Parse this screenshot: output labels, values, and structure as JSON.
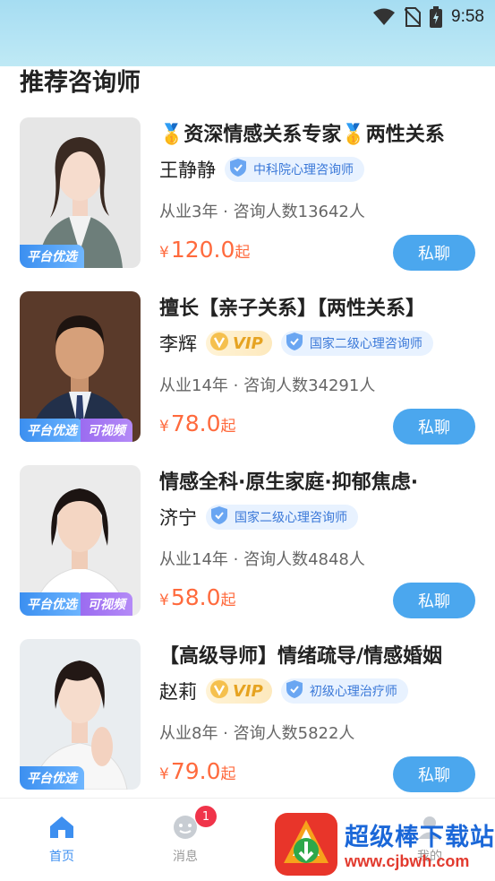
{
  "status_bar": {
    "time": "9:58"
  },
  "section_title": "推荐咨询师",
  "counselors": [
    {
      "title": "🥇资深情感关系专家🥇两性关系",
      "name": "王静静",
      "vip": "",
      "cert": "中科院心理咨询师",
      "stats": "从业3年 · 咨询人数13642人",
      "price_symbol": "¥",
      "price": "120.0",
      "price_suffix": "起",
      "chat_label": "私聊",
      "badge_pick": "平台优选",
      "badge_video": ""
    },
    {
      "title": "擅长【亲子关系】【两性关系】",
      "name": "李辉",
      "vip": "VIP",
      "cert": "国家二级心理咨询师",
      "stats": "从业14年 · 咨询人数34291人",
      "price_symbol": "¥",
      "price": "78.0",
      "price_suffix": "起",
      "chat_label": "私聊",
      "badge_pick": "平台优选",
      "badge_video": "可视频"
    },
    {
      "title": "情感全科·原生家庭·抑郁焦虑·",
      "name": "济宁",
      "vip": "",
      "cert": "国家二级心理咨询师",
      "stats": "从业14年 · 咨询人数4848人",
      "price_symbol": "¥",
      "price": "58.0",
      "price_suffix": "起",
      "chat_label": "私聊",
      "badge_pick": "平台优选",
      "badge_video": "可视频"
    },
    {
      "title": "【高级导师】情绪疏导/情感婚姻",
      "name": "赵莉",
      "vip": "VIP",
      "cert": "初级心理治疗师",
      "stats": "从业8年 · 咨询人数5822人",
      "price_symbol": "¥",
      "price": "79.0",
      "price_suffix": "起",
      "chat_label": "私聊",
      "badge_pick": "平台优选",
      "badge_video": ""
    }
  ],
  "bottom_nav": {
    "home": "首页",
    "messages": "消息",
    "messages_badge": "1",
    "mine": "我的"
  },
  "watermark": {
    "title": "超级棒下载站",
    "url": "www.cjbwh.com"
  },
  "colors": {
    "accent": "#4ba7ee",
    "price": "#ff6a3d",
    "vip": "#e6a321",
    "cert": "#3a78d8"
  }
}
